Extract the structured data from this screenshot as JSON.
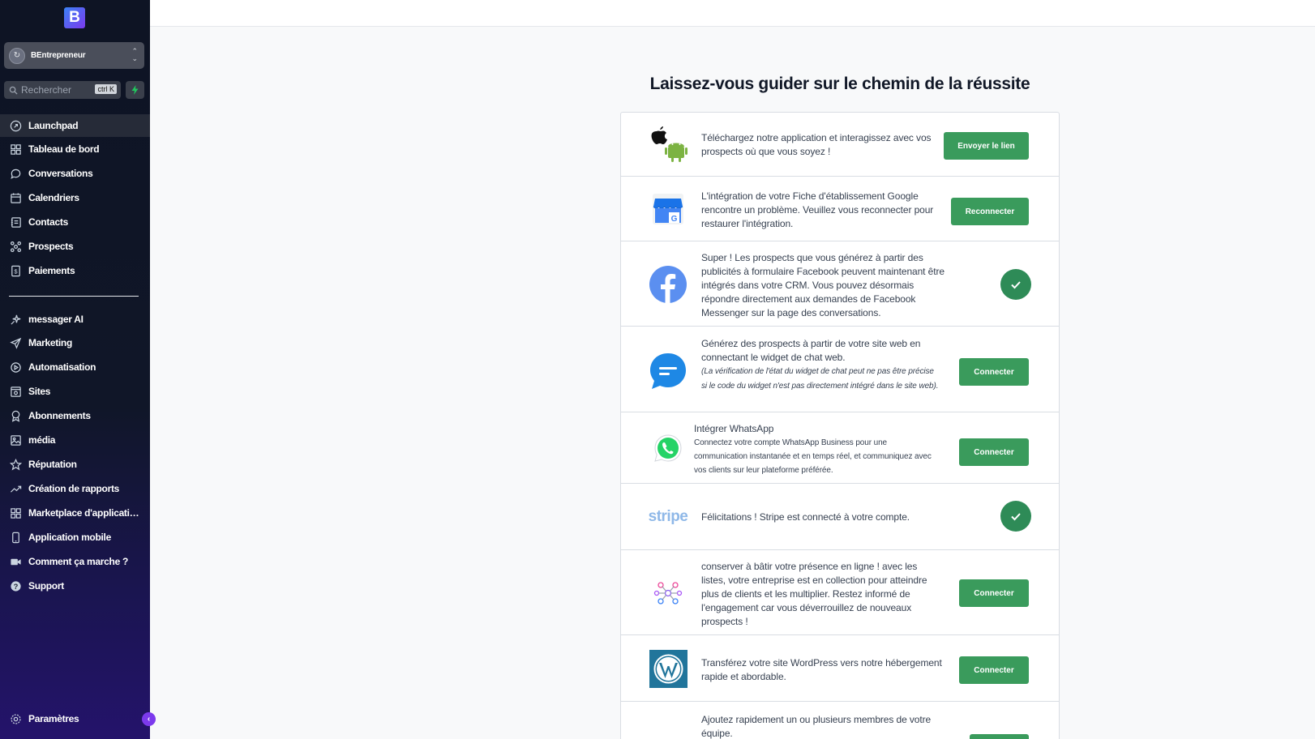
{
  "sidebar": {
    "logo": "B",
    "account": {
      "avatar": "↻",
      "name": "BEntrepreneur"
    },
    "search": {
      "placeholder": "Rechercher",
      "shortcut": "ctrl K"
    },
    "items": [
      {
        "label": "Launchpad",
        "icon": "rocket-icon"
      },
      {
        "label": "Tableau de bord",
        "icon": "dashboard-icon"
      },
      {
        "label": "Conversations",
        "icon": "chat-icon"
      },
      {
        "label": "Calendriers",
        "icon": "calendar-icon"
      },
      {
        "label": "Contacts",
        "icon": "contacts-icon"
      },
      {
        "label": "Prospects",
        "icon": "prospects-icon"
      },
      {
        "label": "Paiements",
        "icon": "payments-icon"
      },
      {
        "label": "messager AI",
        "icon": "sparkle-icon"
      },
      {
        "label": "Marketing",
        "icon": "send-icon"
      },
      {
        "label": "Automatisation",
        "icon": "automation-icon"
      },
      {
        "label": "Sites",
        "icon": "sites-icon"
      },
      {
        "label": "Abonnements",
        "icon": "award-icon"
      },
      {
        "label": "média",
        "icon": "media-icon"
      },
      {
        "label": "Réputation",
        "icon": "star-icon"
      },
      {
        "label": "Création de rapports",
        "icon": "trend-icon"
      },
      {
        "label": "Marketplace d'applicatio...",
        "icon": "grid-icon"
      },
      {
        "label": "Application mobile",
        "icon": "phone-icon"
      },
      {
        "label": "Comment ça marche ?",
        "icon": "video-icon"
      },
      {
        "label": "Support",
        "icon": "help-icon"
      }
    ],
    "settings": "Paramètres",
    "collapse": "‹"
  },
  "main": {
    "title": "Laissez-vous guider sur le chemin de la réussite",
    "rows": [
      {
        "text": "Téléchargez notre application et interagissez avec vos prospects où que vous soyez !",
        "button": "Envoyer le lien",
        "icon": "apple-android-icon"
      },
      {
        "text": "L'intégration de votre Fiche d'établissement Google rencontre un problème. Veuillez vous reconnecter pour restaurer l'intégration.",
        "button": "Reconnecter",
        "icon": "google-business-icon"
      },
      {
        "text": "Super ! Les prospects que vous générez à partir des publicités à formulaire Facebook peuvent maintenant être intégrés dans votre CRM. Vous pouvez désormais répondre directement aux demandes de Facebook Messenger sur la page des conversations.",
        "status": "connected",
        "icon": "facebook-icon"
      },
      {
        "text": "Générez des prospects à partir de votre site web en connectant le widget de chat web.",
        "note": "(La vérification de l'état du widget de chat peut ne pas être précise si le code du widget n'est pas directement intégré dans le site web).",
        "button": "Connecter",
        "icon": "chat-widget-icon"
      },
      {
        "heading": "Intégrer WhatsApp",
        "text": "Connectez votre compte WhatsApp Business pour une communication instantanée et en temps réel, et communiquez avec vos clients sur leur plateforme préférée.",
        "button": "Connecter",
        "icon": "whatsapp-icon"
      },
      {
        "text": "Félicitations ! Stripe est connecté à votre compte.",
        "status": "connected",
        "icon": "stripe-logo",
        "logo_text": "stripe"
      },
      {
        "text": "conserver à bâtir votre présence en ligne ! avec les listes, votre entreprise est en collection pour atteindre plus de clients et les multiplier. Restez informé de l'engagement car vous déverrouillez de nouveaux prospects !",
        "button": "Connecter",
        "icon": "listings-icon"
      },
      {
        "text": "Transférez votre site WordPress vers notre hébergement rapide et abordable.",
        "button": "Connecter",
        "icon": "wordpress-icon"
      },
      {
        "text": "Ajoutez rapidement un ou plusieurs membres de votre équipe.",
        "button": "",
        "icon": "team-icon"
      }
    ]
  },
  "colors": {
    "sidebar_bg": "#0e1424",
    "button_green": "#3a9b5c",
    "check_green": "#2e8b57",
    "accent_purple": "#7c3aed"
  }
}
